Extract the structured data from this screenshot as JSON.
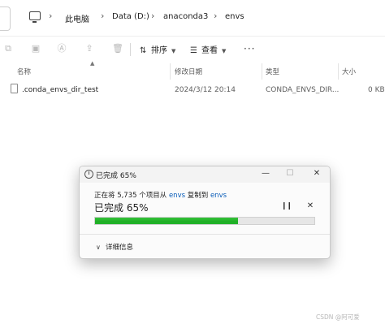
{
  "breadcrumb": [
    "此电脑",
    "Data (D:)",
    "anaconda3",
    "envs"
  ],
  "toolbar": {
    "sort_label": "排序",
    "view_label": "查看",
    "more_label": "···"
  },
  "columns": [
    "名称",
    "修改日期",
    "类型",
    "大小"
  ],
  "files": [
    {
      "name": ".conda_envs_dir_test",
      "modified": "2024/3/12 20:14",
      "type": "CONDA_ENVS_DIR...",
      "size": "0 KB"
    }
  ],
  "dialog": {
    "title": "已完成 65%",
    "copy_prefix": "正在将 5,735 个项目从",
    "source": "envs",
    "copy_middle": "复制到",
    "destination": "envs",
    "status": "已完成 65%",
    "progress_percent": 65,
    "details_label": "详细信息"
  },
  "watermark": "CSDN @阿可爱"
}
